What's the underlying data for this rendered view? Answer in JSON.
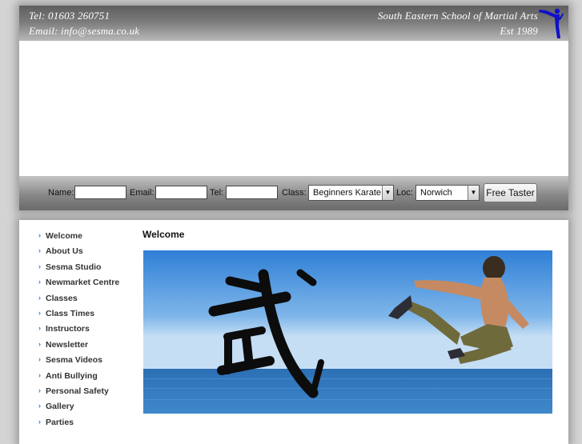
{
  "header": {
    "tel": "Tel: 01603 260751",
    "email": "Email: info@sesma.co.uk",
    "school_name": "South Eastern School of Martial Arts",
    "established": "Est 1989",
    "logo_icon": "martial-artist-kick-icon"
  },
  "form": {
    "name_label": "Name:",
    "email_label": "Email:",
    "tel_label": "Tel:",
    "class_label": "Class:",
    "class_value": "Beginners Karate",
    "loc_label": "Loc:",
    "loc_value": "Norwich",
    "submit_label": "Free Taster"
  },
  "nav": {
    "items": [
      "Welcome",
      "About Us",
      "Sesma Studio",
      "Newmarket Centre",
      "Classes",
      "Class Times",
      "Instructors",
      "Newsletter",
      "Sesma Videos",
      "Anti Bullying",
      "Personal Safety",
      "Gallery",
      "Parties"
    ]
  },
  "main": {
    "title": "Welcome",
    "hero_glyph": "武"
  },
  "colors": {
    "accent": "#2e7fc4",
    "logo_blue": "#1010c8"
  }
}
